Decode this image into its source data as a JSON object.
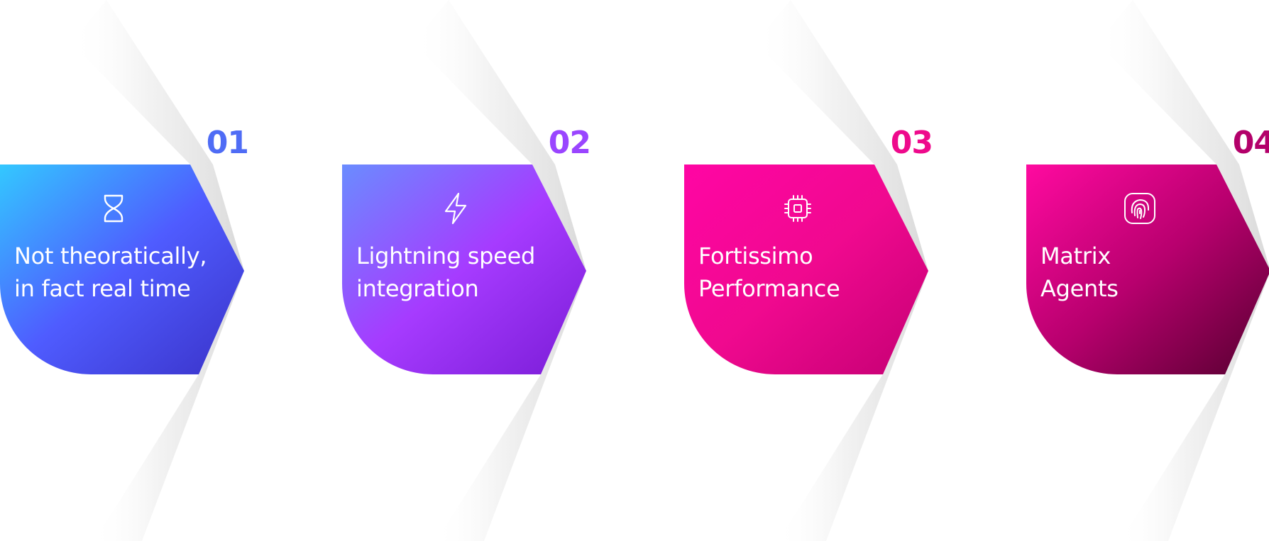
{
  "steps": [
    {
      "number": "01",
      "line1": "Not theoratically,",
      "line2": "in fact real time",
      "icon": "hourglass-icon",
      "number_color": "#4f6cf5",
      "gradient": [
        "#33c8ff",
        "#4f5cff",
        "#3a32c8"
      ]
    },
    {
      "number": "02",
      "line1": "Lightning speed",
      "line2": "integration",
      "icon": "lightning-icon",
      "number_color": "#9a45ff",
      "gradient": [
        "#6a8cff",
        "#a63bff",
        "#7a1cd6"
      ]
    },
    {
      "number": "03",
      "line1": "Fortissimo",
      "line2": "Performance",
      "icon": "chip-icon",
      "number_color": "#ee0a8c",
      "gradient": [
        "#ff05a4",
        "#f0098f",
        "#c40073"
      ]
    },
    {
      "number": "04",
      "line1": "Matrix",
      "line2": "Agents",
      "icon": "fingerprint-icon",
      "number_color": "#b3006a",
      "gradient": [
        "#ff0aa0",
        "#b8006e",
        "#55002f"
      ]
    }
  ]
}
